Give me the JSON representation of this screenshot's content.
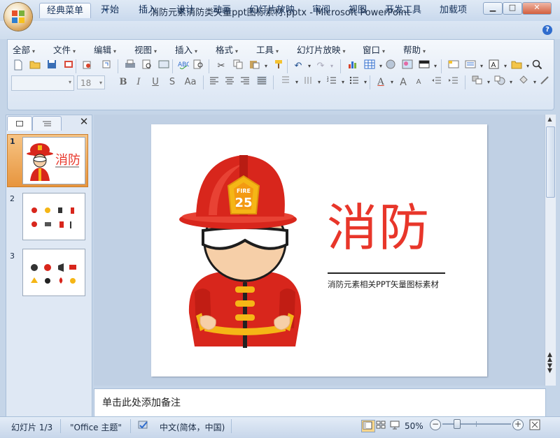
{
  "window": {
    "title": "消防元素消防类矢量ppt图标素材.pptx - Microsoft PowerPoint",
    "minimize_glyph": "▁",
    "maximize_glyph": "□",
    "close_glyph": "✕"
  },
  "ribbon_tabs": [
    "经典菜单",
    "开始",
    "插入",
    "设计",
    "动画",
    "幻灯片放映",
    "审阅",
    "视图",
    "开发工具",
    "加载项"
  ],
  "active_tab": "经典菜单",
  "classic_menus": [
    "全部",
    "文件",
    "编辑",
    "视图",
    "插入",
    "格式",
    "工具",
    "幻灯片放映",
    "窗口",
    "帮助"
  ],
  "font_name": "",
  "font_size": "18",
  "format_buttons": {
    "bold": "B",
    "italic": "I",
    "underline": "U",
    "shadow": "S",
    "case": "Aa"
  },
  "panel": {
    "close_glyph": "✕",
    "slides": [
      {
        "number": "1",
        "title": "消防"
      },
      {
        "number": "2"
      },
      {
        "number": "3"
      }
    ]
  },
  "slide": {
    "title": "消防",
    "subtitle": "消防元素相关PPT矢量图标素材",
    "helmet_text": "FIRE",
    "helmet_number": "25"
  },
  "notes_placeholder": "单击此处添加备注",
  "status": {
    "slide_info": "幻灯片 1/3",
    "theme": "\"Office 主题\"",
    "language": "中文(简体，中国)",
    "zoom": "50%"
  },
  "colors": {
    "accent_red": "#e8362a",
    "helmet_red": "#d8261c",
    "badge_yellow": "#f5b616"
  }
}
